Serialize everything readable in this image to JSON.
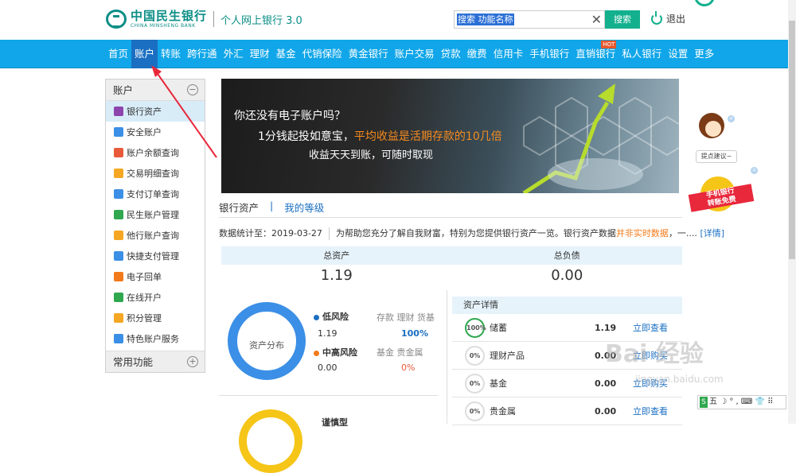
{
  "header": {
    "logo_cn": "中国民生银行",
    "logo_en": "CHINA MINSHENG BANK",
    "subtitle": "个人网上银行 3.0",
    "search_value": "搜索 功能名称",
    "search_button": "搜索",
    "logout": "退出"
  },
  "nav": {
    "items": [
      "首页",
      "账户",
      "转账",
      "跨行通",
      "外汇",
      "理财",
      "基金",
      "代销保险",
      "黄金银行",
      "账户交易",
      "贷款",
      "缴费",
      "信用卡",
      "手机银行",
      "直销银行",
      "私人银行",
      "设置",
      "更多"
    ],
    "active_index": 1,
    "hot_badge": "HOT"
  },
  "sidebar": {
    "title": "账户",
    "toggle": "−",
    "items": [
      {
        "label": "银行资产",
        "icon_color": "#8e44ad"
      },
      {
        "label": "安全账户",
        "icon_color": "#3b8fe6"
      },
      {
        "label": "账户余额查询",
        "icon_color": "#e85a3a"
      },
      {
        "label": "交易明细查询",
        "icon_color": "#f5a623"
      },
      {
        "label": "支付订单查询",
        "icon_color": "#3b8fe6"
      },
      {
        "label": "民生账户管理",
        "icon_color": "#2fa84f"
      },
      {
        "label": "他行账户查询",
        "icon_color": "#f5a623"
      },
      {
        "label": "快捷支付管理",
        "icon_color": "#3b8fe6"
      },
      {
        "label": "电子回单",
        "icon_color": "#f27a1a"
      },
      {
        "label": "在线开户",
        "icon_color": "#2fa84f"
      },
      {
        "label": "积分管理",
        "icon_color": "#f5a623"
      },
      {
        "label": "特色账户服务",
        "icon_color": "#3b8fe6"
      }
    ],
    "footer": "常用功能",
    "footer_toggle": "+"
  },
  "banner": {
    "line1": "你还没有电子账户吗？",
    "line2_prefix": "1分钱起投如意宝，",
    "line2_highlight": "平均收益是活期存款的10几倍",
    "line3": "收益天天到账，可随时取现"
  },
  "tabs": {
    "tab1": "银行资产",
    "sep": "|",
    "tab2": "我的等级"
  },
  "stats": {
    "date_label": "数据统计至：2019-03-27",
    "note_prefix": "为帮助您充分了解自我财富，特别为您提供银行资产一览。银行资产数据",
    "note_highlight": "并非实时数据",
    "note_suffix": "，一....",
    "detail_link": "[详情]"
  },
  "totals": {
    "assets_label": "总资产",
    "liabilities_label": "总负债",
    "assets_value": "1.19",
    "liabilities_value": "0.00"
  },
  "distribution": {
    "center_label": "资产分布",
    "low_risk_label": "低风险",
    "low_risk_types": "存款 理财 货基",
    "low_risk_value": "1.19",
    "low_risk_pct": "100%",
    "mid_risk_label": "中高风险",
    "mid_risk_types": "基金 贵金属",
    "mid_risk_value": "0.00",
    "mid_risk_pct": "0%",
    "next_label": "谨慎型",
    "low_color": "#1b6fc2",
    "mid_color": "#f27a1a"
  },
  "details": {
    "title": "资产详情",
    "rows": [
      {
        "pct": "100%",
        "name": "储蓄",
        "amount": "1.19",
        "action": "立即查看"
      },
      {
        "pct": "0%",
        "name": "理财产品",
        "amount": "0.00",
        "action": "立即购买"
      },
      {
        "pct": "0%",
        "name": "基金",
        "amount": "0.00",
        "action": "立即购买"
      },
      {
        "pct": "0%",
        "name": "贵金属",
        "amount": "0.00",
        "action": "立即查看"
      }
    ]
  },
  "widgets": {
    "suggest": "提点建议~",
    "promo_line1": "手机银行",
    "promo_line2": "转账免费",
    "close": "×"
  },
  "ime": {
    "text": "五 ☽ ° , ⌨ 👕 ⠿"
  },
  "watermark": {
    "main": "Bai 经验",
    "sub": "jingyan.baidu.com"
  }
}
